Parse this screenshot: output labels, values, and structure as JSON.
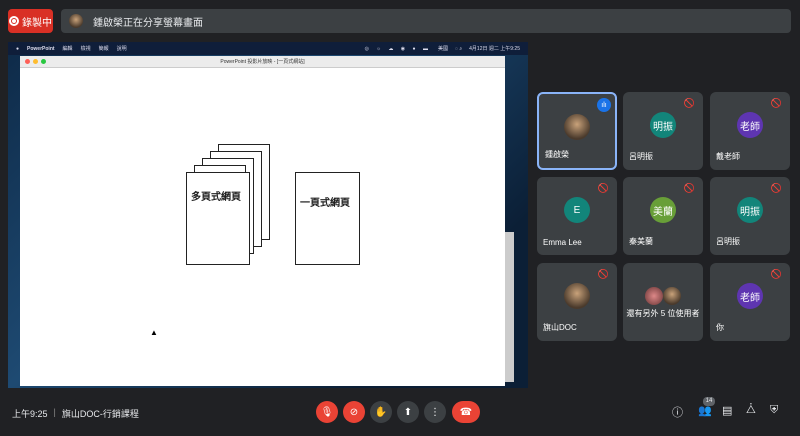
{
  "recording": {
    "label": "錄製中"
  },
  "banner": {
    "text": "鍾啟榮正在分享螢幕畫面"
  },
  "shared_screen": {
    "menubar": {
      "items": [
        "PowerPoint",
        "編輯",
        "檢視",
        "簡報",
        "說明"
      ],
      "status": "美國",
      "clock": "4月12日 週二 上午9:25"
    },
    "window_title": "PowerPoint 投影片放映 - [一頁式網站]",
    "slide": {
      "left_label": "多頁式網頁",
      "right_label": "一頁式網頁"
    }
  },
  "participants": [
    {
      "name": "鍾啟榮",
      "initials": "",
      "color": "",
      "speaking": true
    },
    {
      "name": "呂明振",
      "initials": "明振",
      "color": "#12857a"
    },
    {
      "name": "戴老師",
      "initials": "老師",
      "color": "#5e35b1"
    },
    {
      "name": "Emma Lee",
      "initials": "E",
      "color": "#12857a"
    },
    {
      "name": "秦美蘭",
      "initials": "美蘭",
      "color": "#689f38"
    },
    {
      "name": "呂明振",
      "initials": "明振",
      "color": "#12857a"
    },
    {
      "name": "旗山DOC",
      "initials": "",
      "color": ""
    },
    {
      "name": "還有另外 5 位使用者",
      "initials": "",
      "color": ""
    },
    {
      "name": "你",
      "initials": "老師",
      "color": "#5e35b1"
    }
  ],
  "bottom": {
    "time": "上午9:25",
    "separator": "|",
    "meeting": "旗山DOC-行銷課程",
    "participant_count": "14"
  }
}
